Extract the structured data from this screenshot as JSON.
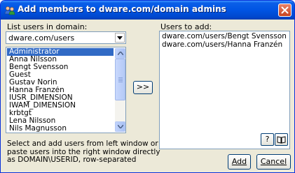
{
  "window": {
    "title": "Add members to dware.com/domain admins"
  },
  "left": {
    "label": "List users in domain:",
    "domain_selected": "dware.com/users",
    "users": [
      "Administrator",
      "Anna Nilsson",
      "Bengt Svensson",
      "Guest",
      "Gustav Norin",
      "Hanna Franzén",
      "IUSR_DIMENSION",
      "IWAM_DIMENSION",
      "krbtgt",
      "Lena Nilsson",
      "Nils Magnusson"
    ],
    "selected_user": "Administrator"
  },
  "transfer_button": ">>",
  "right": {
    "label": "Users to add:",
    "entries": [
      "dware.com/users/Bengt Svensson",
      "dware.com/users/Hanna Franzén"
    ]
  },
  "help_button": "?",
  "help_text": [
    "Select and add users from left window or",
    "paste users into the right window directly",
    "as DOMAIN\\USERID, row-separated"
  ],
  "buttons": {
    "add": "Add",
    "cancel": "Cancel"
  },
  "icons": {
    "title": "users-icon",
    "close": "close-icon",
    "book": "book-icon"
  }
}
